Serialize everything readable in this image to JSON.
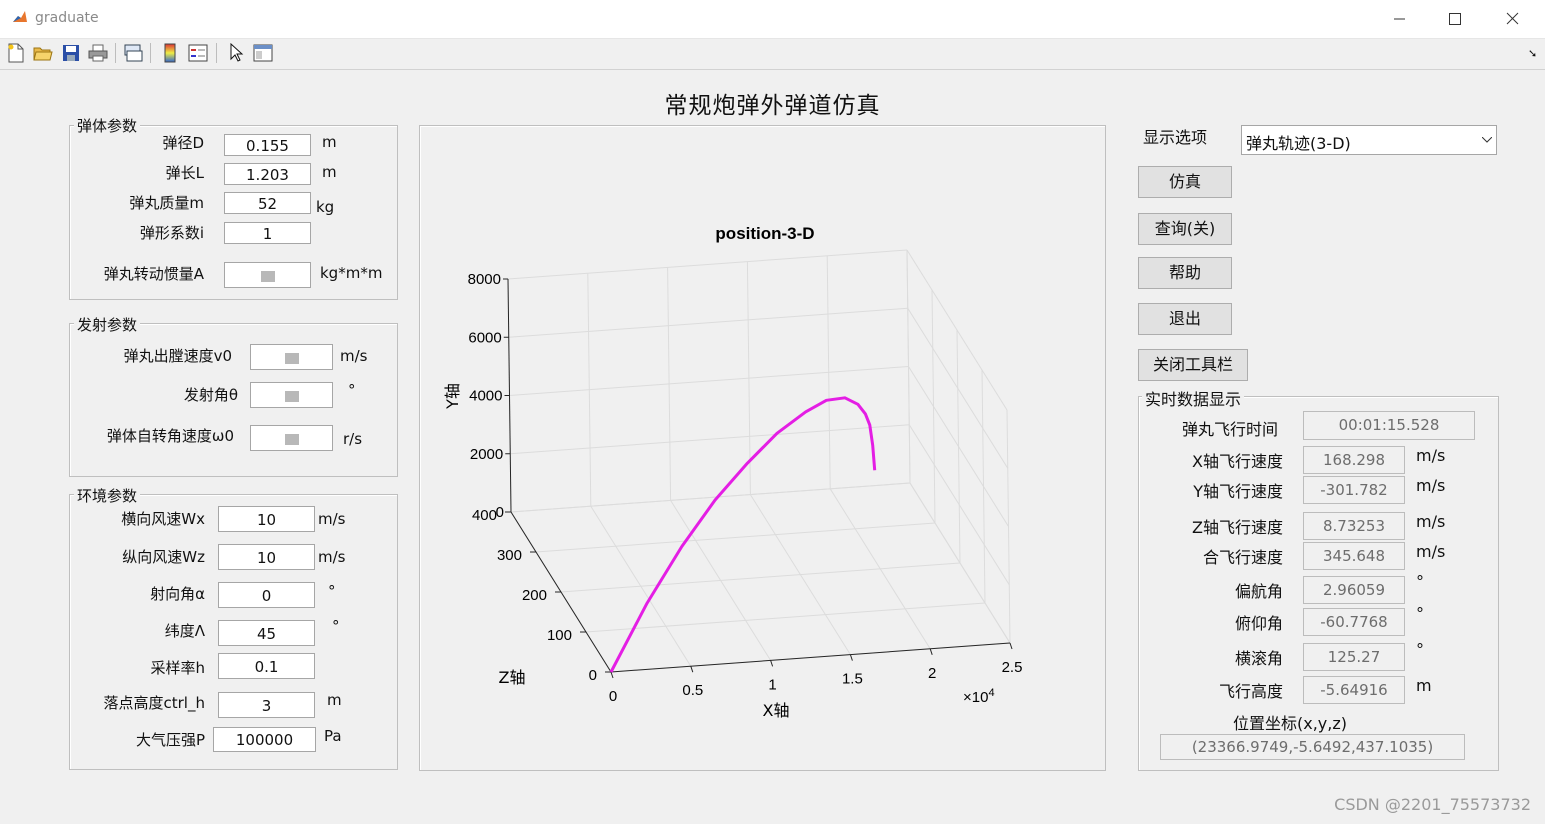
{
  "window": {
    "title": "graduate"
  },
  "page_title": "常规炮弹外弹道仿真",
  "projectile_panel": {
    "title": "弹体参数",
    "fields": [
      {
        "label": "弹径D",
        "value": "0.155",
        "unit": "m"
      },
      {
        "label": "弹长L",
        "value": "1.203",
        "unit": "m"
      },
      {
        "label": "弹丸质量m",
        "value": "52",
        "unit": "kg"
      },
      {
        "label": "弹形系数i",
        "value": "1",
        "unit": ""
      },
      {
        "label": "弹丸转动惯量A",
        "value": "",
        "unit": "kg*m*m"
      }
    ]
  },
  "launch_panel": {
    "title": "发射参数",
    "fields": [
      {
        "label": "弹丸出膛速度v0",
        "value": "",
        "unit": "m/s"
      },
      {
        "label": "发射角θ",
        "value": "",
        "unit": "°"
      },
      {
        "label": "弹体自转角速度ω0",
        "value": "",
        "unit": "r/s"
      }
    ]
  },
  "env_panel": {
    "title": "环境参数",
    "fields": [
      {
        "label": "横向风速Wx",
        "value": "10",
        "unit": "m/s"
      },
      {
        "label": "纵向风速Wz",
        "value": "10",
        "unit": "m/s"
      },
      {
        "label": "射向角α",
        "value": "0",
        "unit": "°"
      },
      {
        "label": "纬度Λ",
        "value": "45",
        "unit": "°"
      },
      {
        "label": "采样率h",
        "value": "0.1",
        "unit": ""
      },
      {
        "label": "落点高度ctrl_h",
        "value": "3",
        "unit": "m"
      },
      {
        "label": "大气压强P",
        "value": "100000",
        "unit": "Pa"
      }
    ]
  },
  "display_option": {
    "label": "显示选项",
    "selected": "弹丸轨迹(3-D)"
  },
  "buttons": {
    "simulate": "仿真",
    "query": "查询(关)",
    "help": "帮助",
    "exit": "退出",
    "close_toolbar": "关闭工具栏"
  },
  "realtime_panel": {
    "title": "实时数据显示",
    "flight_time": {
      "label": "弹丸飞行时间",
      "value": "00:01:15.528"
    },
    "rows": [
      {
        "label": "X轴飞行速度",
        "value": "168.298",
        "unit": "m/s"
      },
      {
        "label": "Y轴飞行速度",
        "value": "-301.782",
        "unit": "m/s"
      },
      {
        "label": "Z轴飞行速度",
        "value": "8.73253",
        "unit": "m/s"
      },
      {
        "label": "合飞行速度",
        "value": "345.648",
        "unit": "m/s"
      },
      {
        "label": "偏航角",
        "value": "2.96059",
        "unit": "°"
      },
      {
        "label": "俯仰角",
        "value": "-60.7768",
        "unit": "°"
      },
      {
        "label": "横滚角",
        "value": "125.27",
        "unit": "°"
      },
      {
        "label": "飞行高度",
        "value": "-5.64916",
        "unit": "m"
      }
    ],
    "position_label": "位置坐标(x,y,z)",
    "position_value": "(23366.9749,-5.6492,437.1035)"
  },
  "plot": {
    "title": "position-3-D",
    "xlabel": "X轴",
    "ylabel": "Y轴",
    "zlabel": "Z轴",
    "x_exponent": "×10^4",
    "x_ticks": [
      "0",
      "0.5",
      "1",
      "1.5",
      "2",
      "2.5"
    ],
    "y_ticks": [
      "0",
      "2000",
      "4000",
      "6000",
      "8000"
    ],
    "z_ticks": [
      "0",
      "100",
      "200",
      "300",
      "400"
    ],
    "line_color": "#e41ee4"
  },
  "chart_data": {
    "type": "line",
    "title": "position-3-D",
    "xlabel": "X轴",
    "ylabel": "Y轴",
    "zlabel": "Z轴",
    "xlim": [
      0,
      25000
    ],
    "ylim": [
      0,
      8000
    ],
    "zlim": [
      0,
      400
    ],
    "grid": true,
    "series": [
      {
        "x": [
          0,
          2500,
          5000,
          7500,
          10000,
          12500,
          15000,
          17000,
          19000,
          20500,
          21500,
          22300,
          23000,
          23367
        ],
        "y": [
          0,
          2100,
          3700,
          4850,
          5600,
          5980,
          6000,
          5700,
          4950,
          4050,
          3200,
          2300,
          1100,
          -5.6
        ],
        "z": [
          0,
          12,
          30,
          55,
          85,
          125,
          170,
          215,
          270,
          315,
          350,
          385,
          420,
          437
        ]
      }
    ]
  },
  "watermark": "CSDN @2201_75573732"
}
